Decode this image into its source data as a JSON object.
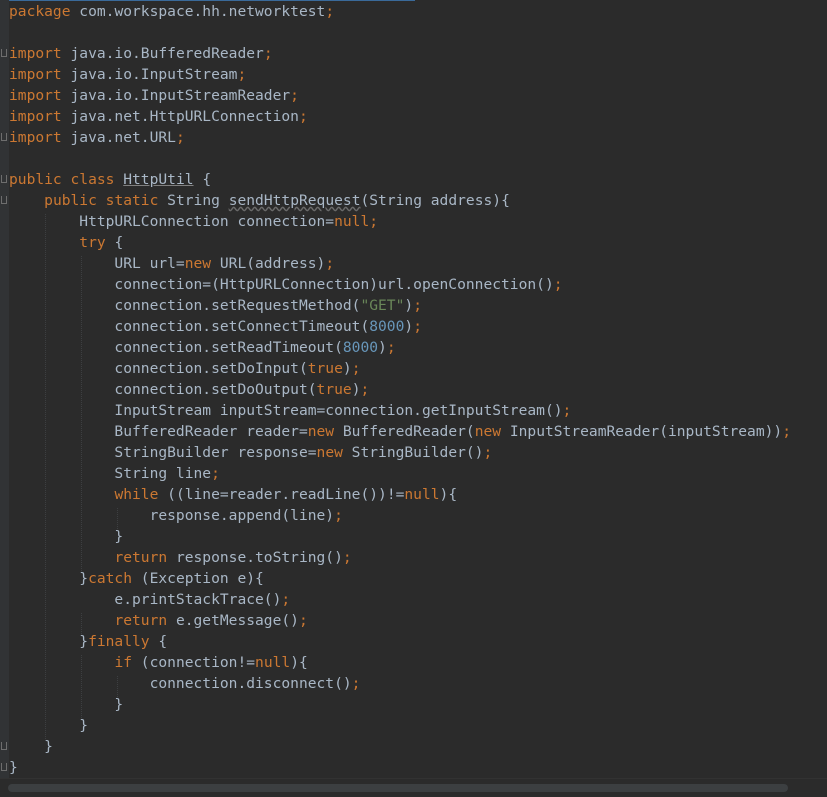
{
  "editor": {
    "lines": [
      [
        {
          "t": "package",
          "c": "kw"
        },
        {
          "t": " com.workspace.hh.networktest"
        },
        {
          "t": ";",
          "c": "kw"
        }
      ],
      [],
      [
        {
          "t": "import",
          "c": "kw"
        },
        {
          "t": " java.io.BufferedReader"
        },
        {
          "t": ";",
          "c": "kw"
        }
      ],
      [
        {
          "t": "import",
          "c": "kw"
        },
        {
          "t": " java.io.InputStream"
        },
        {
          "t": ";",
          "c": "kw"
        }
      ],
      [
        {
          "t": "import",
          "c": "kw"
        },
        {
          "t": " java.io.InputStreamReader"
        },
        {
          "t": ";",
          "c": "kw"
        }
      ],
      [
        {
          "t": "import",
          "c": "kw"
        },
        {
          "t": " java.net.HttpURLConnection"
        },
        {
          "t": ";",
          "c": "kw"
        }
      ],
      [
        {
          "t": "import",
          "c": "kw"
        },
        {
          "t": " java.net.URL"
        },
        {
          "t": ";",
          "c": "kw"
        }
      ],
      [],
      [
        {
          "t": "public class ",
          "c": "kw"
        },
        {
          "t": "HttpUtil",
          "c": "usage"
        },
        {
          "t": " {"
        }
      ],
      [
        {
          "t": "    "
        },
        {
          "t": "public static ",
          "c": "kw"
        },
        {
          "t": "String "
        },
        {
          "t": "sendHttpRequest",
          "c": "warn"
        },
        {
          "t": "(String address){"
        }
      ],
      [
        {
          "t": "        HttpURLConnection connection="
        },
        {
          "t": "null;",
          "c": "kw"
        }
      ],
      [
        {
          "t": "        "
        },
        {
          "t": "try",
          "c": "kw"
        },
        {
          "t": " {"
        }
      ],
      [
        {
          "t": "            URL url="
        },
        {
          "t": "new",
          "c": "kw"
        },
        {
          "t": " URL(address)"
        },
        {
          "t": ";",
          "c": "kw"
        }
      ],
      [
        {
          "t": "            connection=(HttpURLConnection)url.openConnection()"
        },
        {
          "t": ";",
          "c": "kw"
        }
      ],
      [
        {
          "t": "            connection.setRequestMethod("
        },
        {
          "t": "\"GET\"",
          "c": "str"
        },
        {
          "t": ")"
        },
        {
          "t": ";",
          "c": "kw"
        }
      ],
      [
        {
          "t": "            connection.setConnectTimeout("
        },
        {
          "t": "8000",
          "c": "num"
        },
        {
          "t": ")"
        },
        {
          "t": ";",
          "c": "kw"
        }
      ],
      [
        {
          "t": "            connection.setReadTimeout("
        },
        {
          "t": "8000",
          "c": "num"
        },
        {
          "t": ")"
        },
        {
          "t": ";",
          "c": "kw"
        }
      ],
      [
        {
          "t": "            connection.setDoInput("
        },
        {
          "t": "true",
          "c": "kw"
        },
        {
          "t": ")"
        },
        {
          "t": ";",
          "c": "kw"
        }
      ],
      [
        {
          "t": "            connection.setDoOutput("
        },
        {
          "t": "true",
          "c": "kw"
        },
        {
          "t": ")"
        },
        {
          "t": ";",
          "c": "kw"
        }
      ],
      [
        {
          "t": "            InputStream inputStream=connection.getInputStream()"
        },
        {
          "t": ";",
          "c": "kw"
        }
      ],
      [
        {
          "t": "            BufferedReader reader="
        },
        {
          "t": "new",
          "c": "kw"
        },
        {
          "t": " BufferedReader("
        },
        {
          "t": "new",
          "c": "kw"
        },
        {
          "t": " InputStreamReader(inputStream))"
        },
        {
          "t": ";",
          "c": "kw"
        }
      ],
      [
        {
          "t": "            StringBuilder response="
        },
        {
          "t": "new",
          "c": "kw"
        },
        {
          "t": " StringBuilder()"
        },
        {
          "t": ";",
          "c": "kw"
        }
      ],
      [
        {
          "t": "            String line"
        },
        {
          "t": ";",
          "c": "kw"
        }
      ],
      [
        {
          "t": "            "
        },
        {
          "t": "while",
          "c": "kw"
        },
        {
          "t": " ((line=reader.readLine())!="
        },
        {
          "t": "null",
          "c": "kw"
        },
        {
          "t": "){"
        }
      ],
      [
        {
          "t": "                response.append(line)"
        },
        {
          "t": ";",
          "c": "kw"
        }
      ],
      [
        {
          "t": "            }"
        }
      ],
      [
        {
          "t": "            "
        },
        {
          "t": "return",
          "c": "kw"
        },
        {
          "t": " response.toString()"
        },
        {
          "t": ";",
          "c": "kw"
        }
      ],
      [
        {
          "t": "        }"
        },
        {
          "t": "catch",
          "c": "kw"
        },
        {
          "t": " (Exception e){"
        }
      ],
      [
        {
          "t": "            e.printStackTrace()"
        },
        {
          "t": ";",
          "c": "kw"
        }
      ],
      [
        {
          "t": "            "
        },
        {
          "t": "return",
          "c": "kw"
        },
        {
          "t": " e.getMessage()"
        },
        {
          "t": ";",
          "c": "kw"
        }
      ],
      [
        {
          "t": "        }"
        },
        {
          "t": "finally",
          "c": "kw"
        },
        {
          "t": " {"
        }
      ],
      [
        {
          "t": "            "
        },
        {
          "t": "if",
          "c": "kw"
        },
        {
          "t": " (connection!="
        },
        {
          "t": "null",
          "c": "kw"
        },
        {
          "t": "){"
        }
      ],
      [
        {
          "t": "                connection.disconnect()"
        },
        {
          "t": ";",
          "c": "kw"
        }
      ],
      [
        {
          "t": "            }"
        }
      ],
      [
        {
          "t": "        }"
        }
      ],
      [
        {
          "t": "    }"
        }
      ],
      [
        {
          "t": "}"
        }
      ]
    ]
  },
  "colors": {
    "background": "#2b2b2b",
    "text": "#a9b7c6",
    "keyword": "#cc7832",
    "string": "#6a8759",
    "number": "#6897bb"
  }
}
